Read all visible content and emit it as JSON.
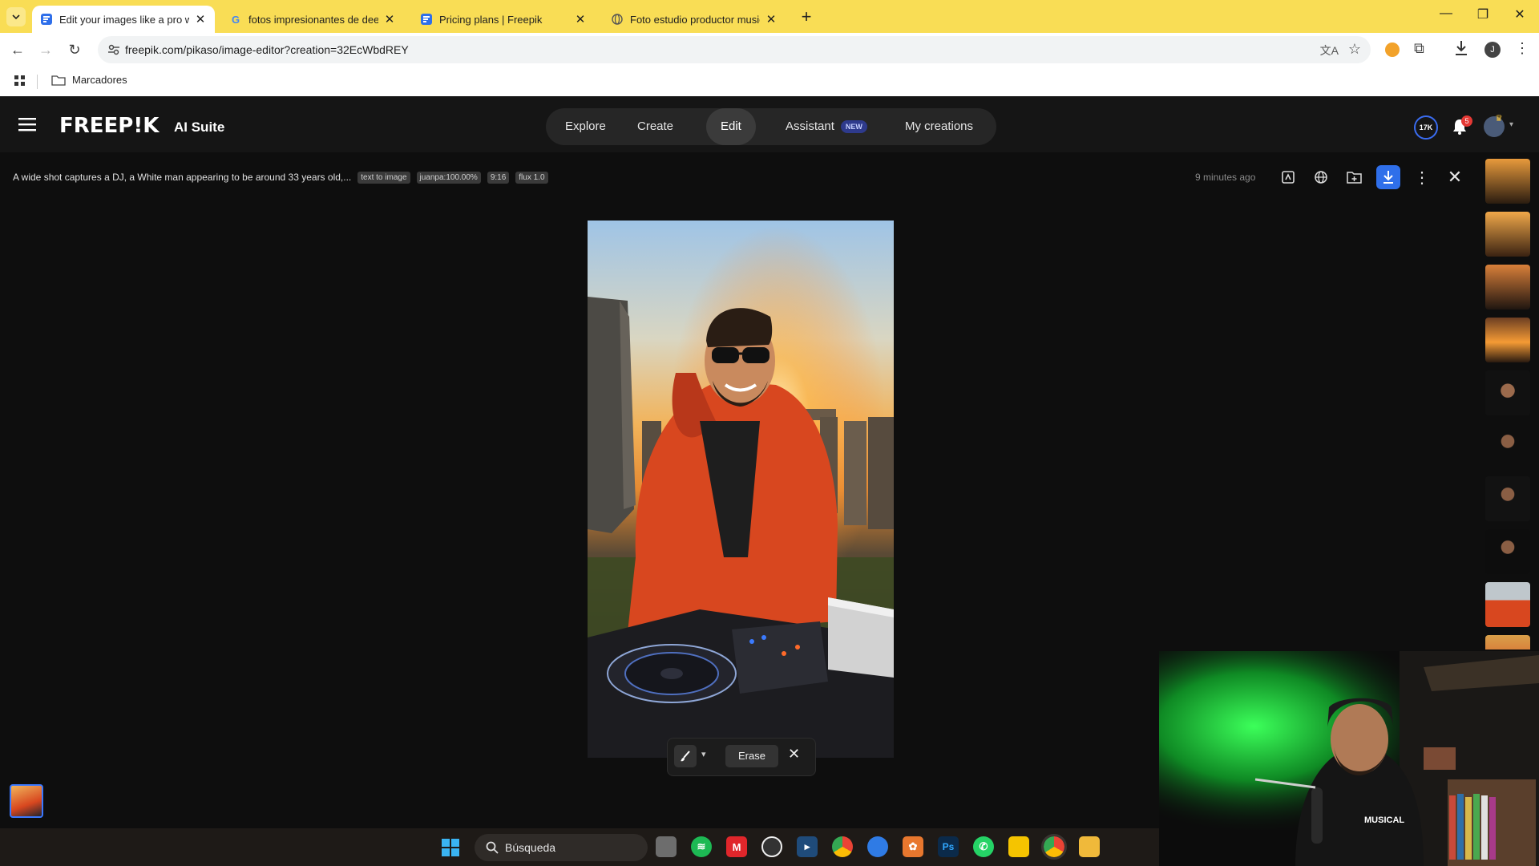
{
  "browser": {
    "tabs": [
      {
        "title": "Edit your images like a pro wit",
        "active": true
      },
      {
        "title": "fotos impresionantes de deejay",
        "active": false
      },
      {
        "title": "Pricing plans | Freepik",
        "active": false
      },
      {
        "title": "Foto estudio productor musical",
        "active": false
      }
    ],
    "url": "freepik.com/pikaso/image-editor?creation=32EcWbdREY",
    "bookmarks_folder": "Marcadores",
    "profile_initial": "J"
  },
  "header": {
    "logo": "FREEP!K",
    "suite": "AI Suite",
    "nav": [
      {
        "label": "Explore"
      },
      {
        "label": "Create"
      },
      {
        "label": "Edit",
        "selected": true
      },
      {
        "label": "Assistant",
        "badge": "NEW"
      },
      {
        "label": "My creations"
      }
    ],
    "credits": "17K",
    "notifications": "5"
  },
  "editor": {
    "prompt": "A wide shot captures a DJ, a White man appearing to be around 33 years old,...",
    "tags": [
      "text to image",
      "juanpa:100.00%",
      "9:16",
      "flux 1.0"
    ],
    "time_ago": "9 minutes ago",
    "erase_label": "Erase"
  },
  "taskbar": {
    "search_placeholder": "Búsqueda",
    "webcam_shirt_text": "MUSICAL"
  },
  "colors": {
    "tabstrip": "#f9dd55",
    "accent_blue": "#2f6fea",
    "app_bg": "#0e0e0e",
    "jacket": "#d8471f"
  }
}
